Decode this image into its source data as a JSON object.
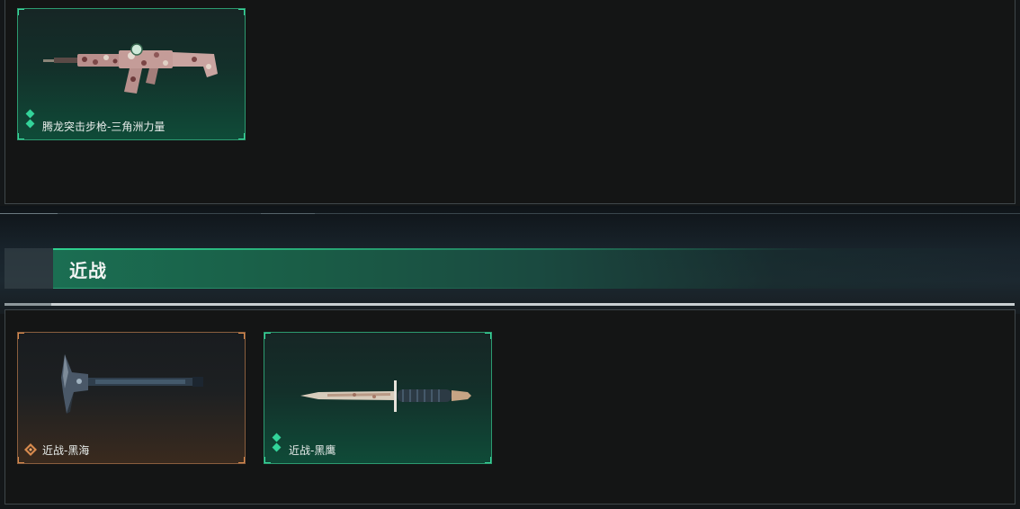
{
  "colors": {
    "accent_green": "#33d39a",
    "rarity_orange": "#d98b4e",
    "panel_bg": "#141515"
  },
  "top_section": {
    "items": [
      {
        "name": "腾龙突击步枪-三角洲力量",
        "icon": "assault-rifle-icon",
        "rarity": "green"
      }
    ]
  },
  "melee_section": {
    "title": "近战",
    "items": [
      {
        "name": "近战-黑海",
        "icon": "tomahawk-icon",
        "rarity": "orange"
      },
      {
        "name": "近战-黑鹰",
        "icon": "combat-knife-icon",
        "rarity": "green"
      }
    ]
  }
}
